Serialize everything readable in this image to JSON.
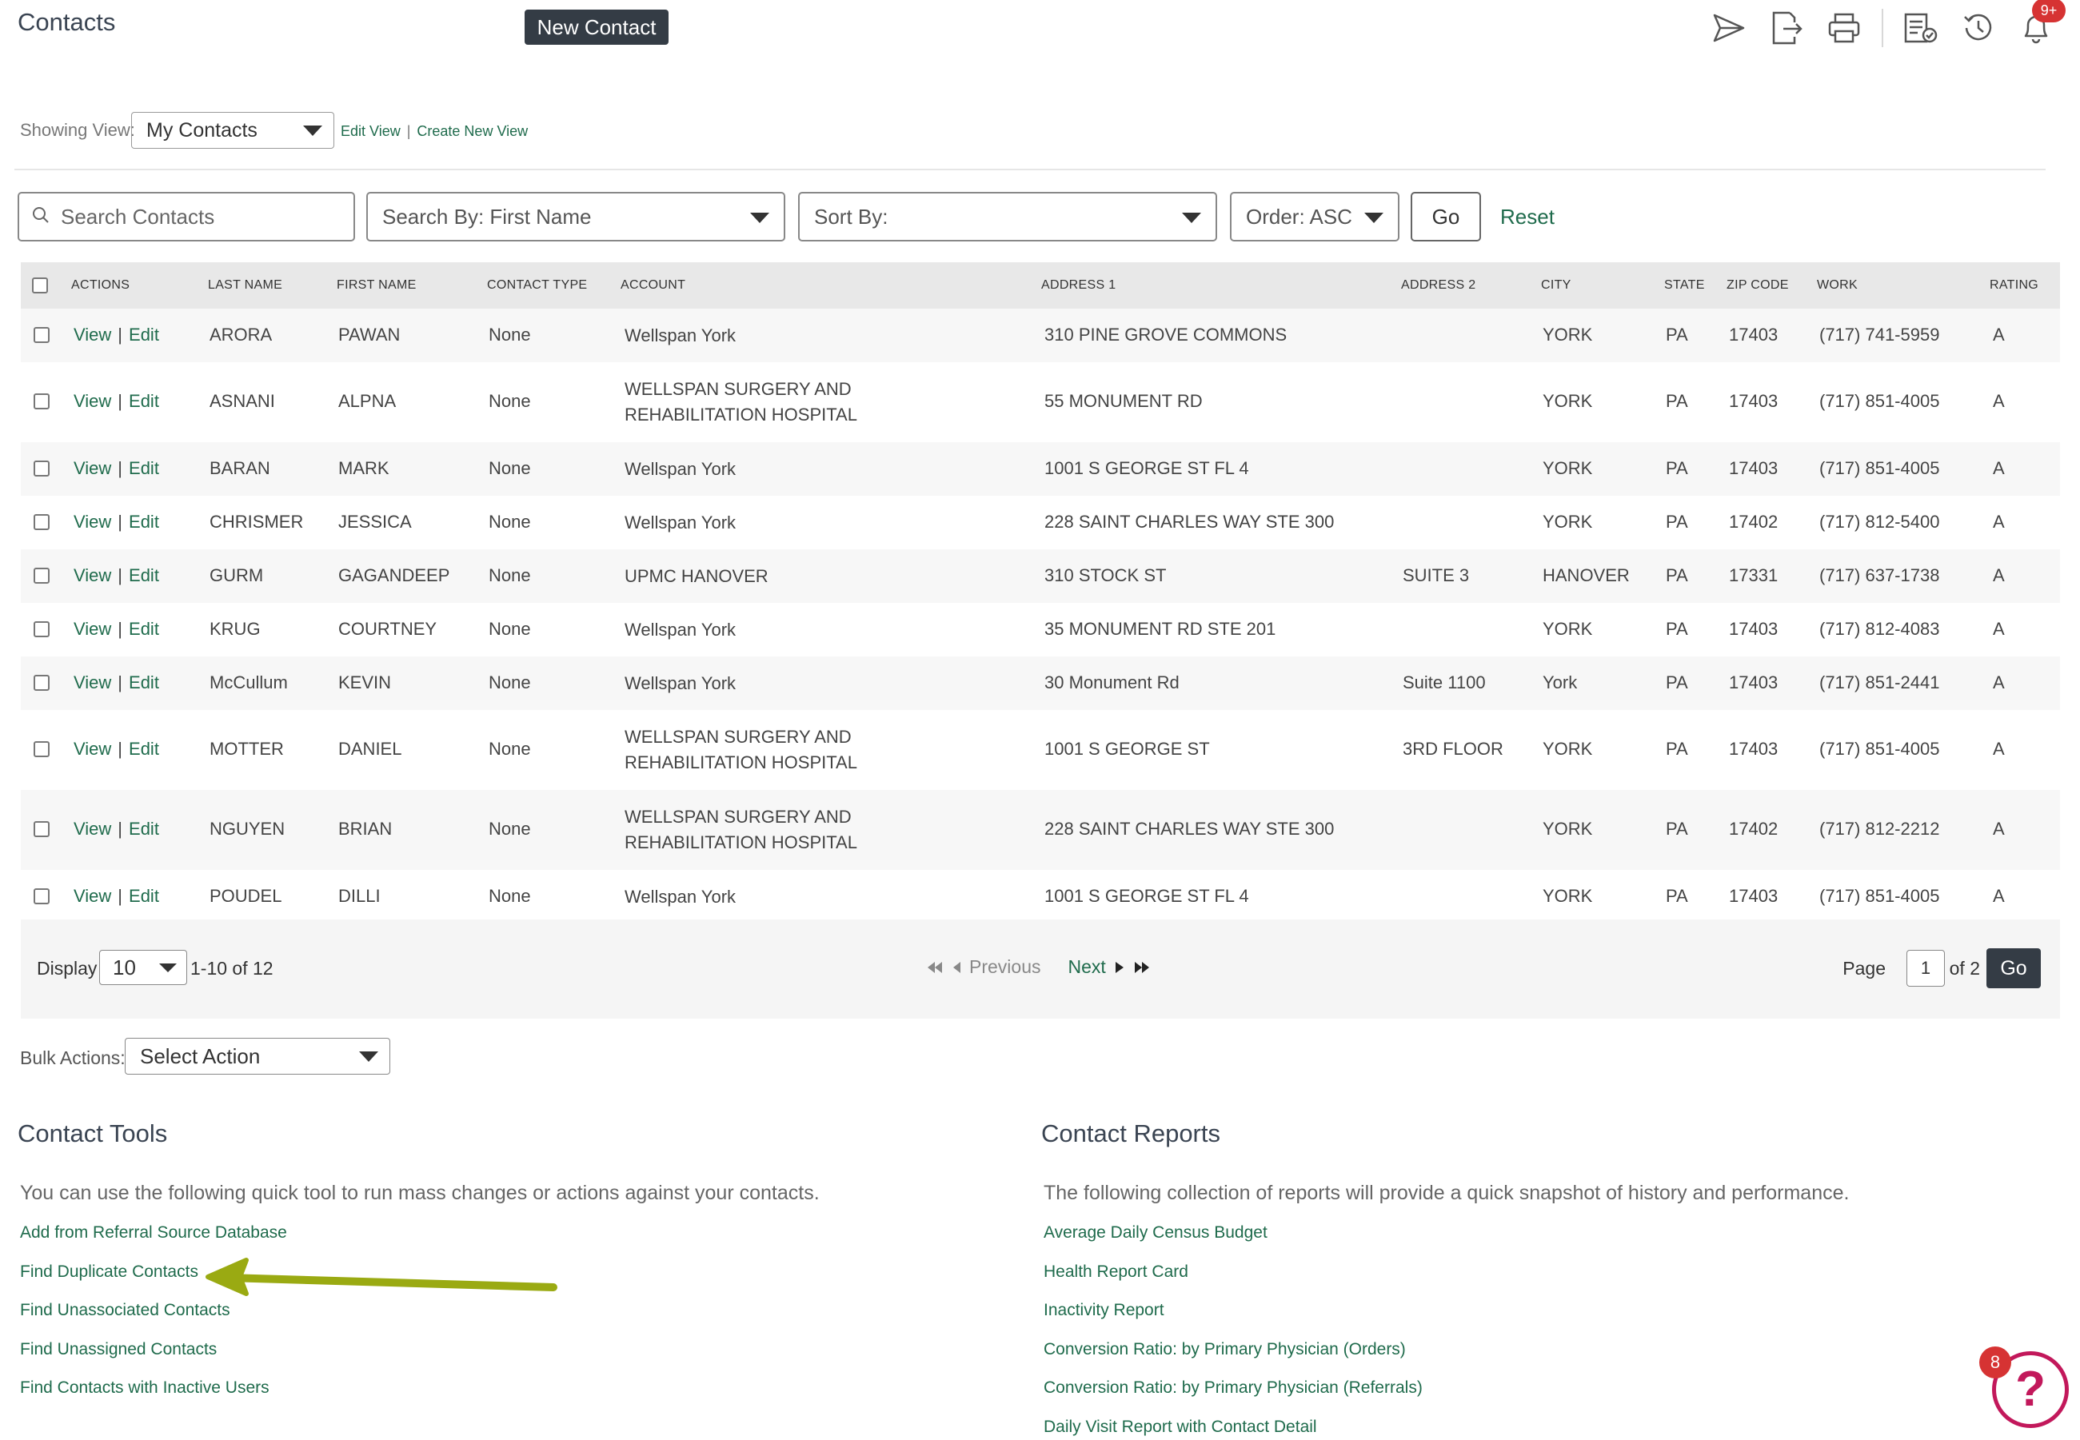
{
  "header": {
    "title": "Contacts",
    "new_contact_label": "New Contact",
    "notification_count": "9+",
    "icons": [
      "send-icon",
      "export-icon",
      "print-icon",
      "checklist-icon",
      "history-icon",
      "bell-icon"
    ]
  },
  "view": {
    "label": "Showing View:",
    "selected": "My Contacts",
    "edit_link": "Edit View",
    "create_link": "Create New View"
  },
  "filters": {
    "search_placeholder": "Search Contacts",
    "search_by": "Search By:  First Name",
    "sort_by": "Sort By:",
    "order": "Order:  ASC",
    "go_label": "Go",
    "reset_label": "Reset"
  },
  "table": {
    "headers": [
      "ACTIONS",
      "LAST NAME",
      "FIRST NAME",
      "CONTACT TYPE",
      "ACCOUNT",
      "ADDRESS 1",
      "ADDRESS 2",
      "CITY",
      "STATE",
      "ZIP CODE",
      "WORK",
      "RATING"
    ],
    "view_label": "View",
    "edit_label": "Edit",
    "rows": [
      {
        "last": "ARORA",
        "first": "PAWAN",
        "type": "None",
        "account": [
          "Wellspan York"
        ],
        "addr1": "310 PINE GROVE COMMONS",
        "addr2": "",
        "city": "YORK",
        "state": "PA",
        "zip": "17403",
        "work": "(717) 741-5959",
        "rating": "A"
      },
      {
        "last": "ASNANI",
        "first": "ALPNA",
        "type": "None",
        "account": [
          "WELLSPAN SURGERY AND",
          "REHABILITATION HOSPITAL"
        ],
        "addr1": "55 MONUMENT RD",
        "addr2": "",
        "city": "YORK",
        "state": "PA",
        "zip": "17403",
        "work": "(717) 851-4005",
        "rating": "A"
      },
      {
        "last": "BARAN",
        "first": "MARK",
        "type": "None",
        "account": [
          "Wellspan York"
        ],
        "addr1": "1001 S GEORGE ST FL 4",
        "addr2": "",
        "city": "YORK",
        "state": "PA",
        "zip": "17403",
        "work": "(717) 851-4005",
        "rating": "A"
      },
      {
        "last": "CHRISMER",
        "first": "JESSICA",
        "type": "None",
        "account": [
          "Wellspan York"
        ],
        "addr1": "228 SAINT CHARLES WAY STE 300",
        "addr2": "",
        "city": "YORK",
        "state": "PA",
        "zip": "17402",
        "work": "(717) 812-5400",
        "rating": "A"
      },
      {
        "last": "GURM",
        "first": "GAGANDEEP",
        "type": "None",
        "account": [
          "UPMC HANOVER"
        ],
        "addr1": "310 STOCK ST",
        "addr2": "SUITE 3",
        "city": "HANOVER",
        "state": "PA",
        "zip": "17331",
        "work": "(717) 637-1738",
        "rating": "A"
      },
      {
        "last": "KRUG",
        "first": "COURTNEY",
        "type": "None",
        "account": [
          "Wellspan York"
        ],
        "addr1": "35 MONUMENT RD STE 201",
        "addr2": "",
        "city": "YORK",
        "state": "PA",
        "zip": "17403",
        "work": "(717) 812-4083",
        "rating": "A"
      },
      {
        "last": "McCullum",
        "first": "KEVIN",
        "type": "None",
        "account": [
          "Wellspan York"
        ],
        "addr1": "30 Monument Rd",
        "addr2": "Suite 1100",
        "city": "York",
        "state": "PA",
        "zip": "17403",
        "work": "(717) 851-2441",
        "rating": "A"
      },
      {
        "last": "MOTTER",
        "first": "DANIEL",
        "type": "None",
        "account": [
          "WELLSPAN SURGERY AND",
          "REHABILITATION HOSPITAL"
        ],
        "addr1": "1001 S GEORGE ST",
        "addr2": "3RD FLOOR",
        "city": "YORK",
        "state": "PA",
        "zip": "17403",
        "work": "(717) 851-4005",
        "rating": "A"
      },
      {
        "last": "NGUYEN",
        "first": "BRIAN",
        "type": "None",
        "account": [
          "WELLSPAN SURGERY AND",
          "REHABILITATION HOSPITAL"
        ],
        "addr1": "228 SAINT CHARLES WAY STE 300",
        "addr2": "",
        "city": "YORK",
        "state": "PA",
        "zip": "17402",
        "work": "(717) 812-2212",
        "rating": "A"
      },
      {
        "last": "POUDEL",
        "first": "DILLI",
        "type": "None",
        "account": [
          "Wellspan York"
        ],
        "addr1": "1001 S GEORGE ST FL 4",
        "addr2": "",
        "city": "YORK",
        "state": "PA",
        "zip": "17403",
        "work": "(717) 851-4005",
        "rating": "A"
      }
    ]
  },
  "pager": {
    "display_label": "Display",
    "display_value": "10",
    "range": "1-10 of 12",
    "previous": "Previous",
    "next": "Next",
    "page_label": "Page",
    "page_value": "1",
    "of_label": "of 2",
    "go_label": "Go"
  },
  "bulk": {
    "label": "Bulk Actions:",
    "selected": "Select Action"
  },
  "tools": {
    "title": "Contact Tools",
    "description": "You can use the following quick tool to run mass changes or actions against your contacts.",
    "links": [
      "Add from Referral Source Database",
      "Find Duplicate Contacts",
      "Find Unassociated Contacts",
      "Find Unassigned Contacts",
      "Find Contacts with Inactive Users"
    ]
  },
  "reports": {
    "title": "Contact Reports",
    "description": "The following collection of reports will provide a quick snapshot of history and performance.",
    "links": [
      "Average Daily Census Budget",
      "Health Report Card",
      "Inactivity Report",
      "Conversion Ratio: by Primary Physician (Orders)",
      "Conversion Ratio: by Primary Physician (Referrals)",
      "Daily Visit Report with Contact Detail"
    ]
  },
  "help": {
    "badge_count": "8",
    "glyph": "?"
  },
  "colors": {
    "link": "#1f6b4c",
    "dark_button": "#343c45",
    "badge": "#d63333",
    "help": "#c2185b",
    "annotation_arrow": "#9aaa12"
  }
}
